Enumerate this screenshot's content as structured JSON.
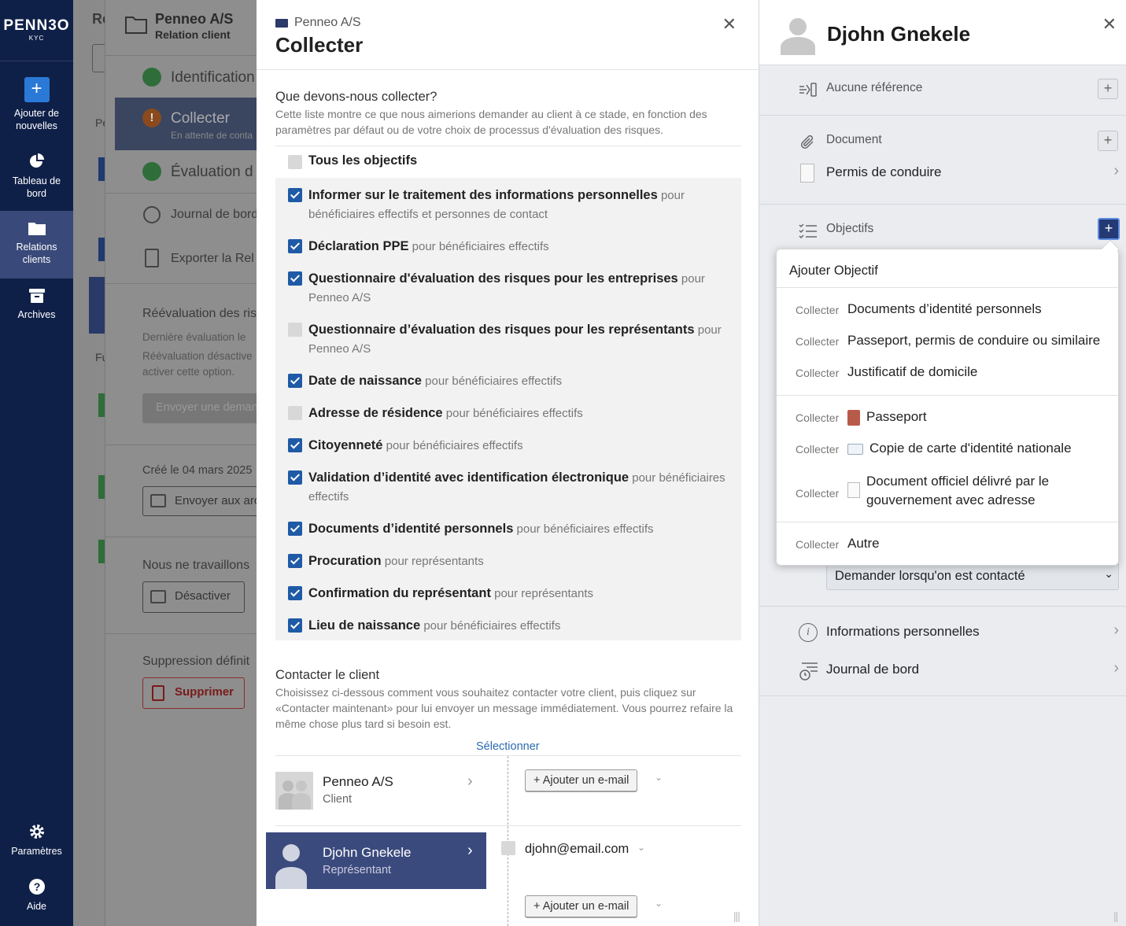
{
  "nav": {
    "logo": "PENN3O",
    "logo_sub": "KYC",
    "add": "Ajouter de nouvelles",
    "dashboard": "Tableau de bord",
    "relations": "Relations clients",
    "archives": "Archives",
    "settings": "Paramètres",
    "help": "Aide"
  },
  "background": {
    "title_cut": "Re",
    "company": "Penneo A/S",
    "company_sub": "Relation client",
    "pe_cut": "Pe",
    "fu_cut": "Fu",
    "step1": "Identification",
    "step2": "Collecter",
    "step2_sub": "En attente de conta",
    "step3": "Évaluation d",
    "journal": "Journal de bord",
    "export": "Exporter la Rel",
    "reeval_title": "Réévaluation des ris",
    "reeval_desc1": "Dernière évaluation le",
    "reeval_desc2": "Réévaluation désactive",
    "reeval_desc3": "activer cette option.",
    "send_request": "Envoyer une deman",
    "created": "Créé le 04 mars 2025",
    "send_archive": "Envoyer aux arc",
    "no_work": "Nous ne travaillons",
    "deactivate": "Désactiver",
    "delete_title": "Suppression définit",
    "delete": "Supprimer"
  },
  "modal": {
    "company": "Penneo A/S",
    "title": "Collecter",
    "question": "Que devons-nous collecter?",
    "question_desc": "Cette liste montre ce que nous aimerions demander au client à ce stade, en fonction des paramètres par défaut ou de votre choix de processus d'évaluation des risques.",
    "all_objectives": "Tous les objectifs",
    "objectives": [
      {
        "title": "Informer sur le traitement des informations personnelles",
        "for": "pour bénéficiaires effectifs et personnes de contact",
        "checked": true
      },
      {
        "title": "Déclaration PPE",
        "for": "pour bénéficiaires effectifs",
        "checked": true
      },
      {
        "title": "Questionnaire d'évaluation des risques pour les entreprises",
        "for": "pour Penneo A/S",
        "checked": true
      },
      {
        "title": "Questionnaire d’évaluation des risques pour les représentants",
        "for": "pour Penneo A/S",
        "checked": false
      },
      {
        "title": "Date de naissance",
        "for": "pour bénéficiaires effectifs",
        "checked": true
      },
      {
        "title": "Adresse de résidence",
        "for": "pour bénéficiaires effectifs",
        "checked": false
      },
      {
        "title": "Citoyenneté",
        "for": "pour bénéficiaires effectifs",
        "checked": true
      },
      {
        "title": "Validation d’identité avec identification électronique",
        "for": "pour bénéficiaires effectifs",
        "checked": true
      },
      {
        "title": "Documents d’identité personnels",
        "for": "pour bénéficiaires effectifs",
        "checked": true
      },
      {
        "title": "Procuration",
        "for": "pour représentants",
        "checked": true
      },
      {
        "title": "Confirmation du représentant",
        "for": "pour représentants",
        "checked": true
      },
      {
        "title": "Lieu de naissance",
        "for": "pour bénéficiaires effectifs",
        "checked": true
      }
    ],
    "contact_title": "Contacter le client",
    "contact_desc": "Choisissez ci-dessous comment vous souhaitez contacter votre client, puis cliquez sur «Contacter maintenant» pour lui envoyer un message immédiatement. Vous pourrez refaire la même chose plus tard si besoin est.",
    "select_label": "Sélectionner",
    "contacts": [
      {
        "name": "Penneo A/S",
        "role": "Client"
      },
      {
        "name": "Djohn Gnekele",
        "role": "Représentant"
      }
    ],
    "add_email": "+ Ajouter un e-mail",
    "email": "djohn@email.com"
  },
  "panel": {
    "name": "Djohn Gnekele",
    "no_reference": "Aucune référence",
    "document": "Document",
    "doc_item": "Permis de conduire",
    "objectives": "Objectifs",
    "ask_option": "Demander lorsqu'on est contacté",
    "personal_info": "Informations personnelles",
    "journal": "Journal de bord"
  },
  "dropdown": {
    "title": "Ajouter Objectif",
    "prefix": "Collecter",
    "group1": [
      "Documents d’identité personnels",
      "Passeport, permis de conduire ou similaire",
      "Justificatif de domicile"
    ],
    "group2": [
      "Passeport",
      "Copie de carte d'identité nationale",
      "Document officiel délivré par le gouvernement avec adresse"
    ],
    "group3": [
      "Autre"
    ]
  },
  "colors": {
    "nav_bg": "#0f2048",
    "nav_active": "#394979",
    "accent": "#1f5aa6",
    "selected_contact": "#3b4a7d"
  }
}
